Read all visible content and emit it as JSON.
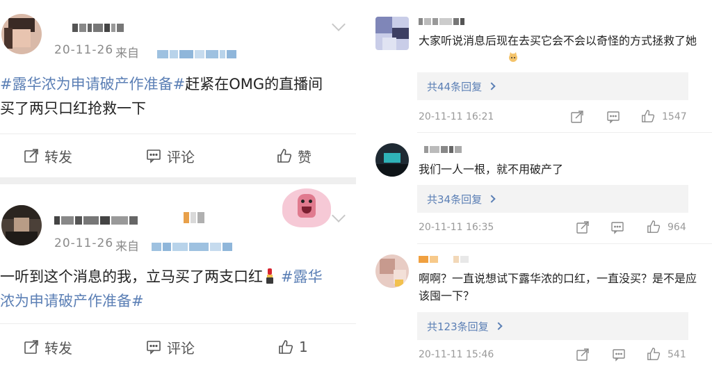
{
  "left": {
    "posts": [
      {
        "time": "20-11-26",
        "source_prefix": "来自",
        "tag": "#露华浓为申请破产作准备#",
        "line1_rest": "赶紧在OMG的直播间",
        "line2": "买了两只口红抢救一下",
        "actions": {
          "repost": "转发",
          "comment": "评论",
          "like": "赞"
        }
      },
      {
        "time": "20-11-26",
        "source_prefix": "来自",
        "line1_text": "一听到这个消息的我，立马买了两支口红",
        "line1_tag": "#露华",
        "line2_tag": "浓为申请破产作准备#",
        "actions": {
          "repost": "转发",
          "comment": "评论",
          "like": "1"
        }
      }
    ]
  },
  "right": {
    "comments": [
      {
        "text": "大家听说消息后现在去买它会不会以奇怪的方式拯救了她",
        "replies": "共44条回复",
        "time": "20-11-11  16:21",
        "likes": "1547"
      },
      {
        "text": "我们一人一根，就不用破产了",
        "replies": "共34条回复",
        "time": "20-11-11  16:35",
        "likes": "964"
      },
      {
        "text": "啊啊？一直说想试下露华浓的口红，一直没买？是不是应该囤一下？",
        "replies": "共123条回复",
        "time": "20-11-11  15:46",
        "likes": "541"
      }
    ]
  },
  "colors": {
    "tag_blue": "#5b7fb5",
    "meta_gray": "#8a8a8a",
    "divider": "#efefef"
  },
  "icons": [
    "repost-icon",
    "comment-icon",
    "like-icon",
    "chevron-down-icon",
    "share-icon",
    "chevron-right-icon"
  ]
}
